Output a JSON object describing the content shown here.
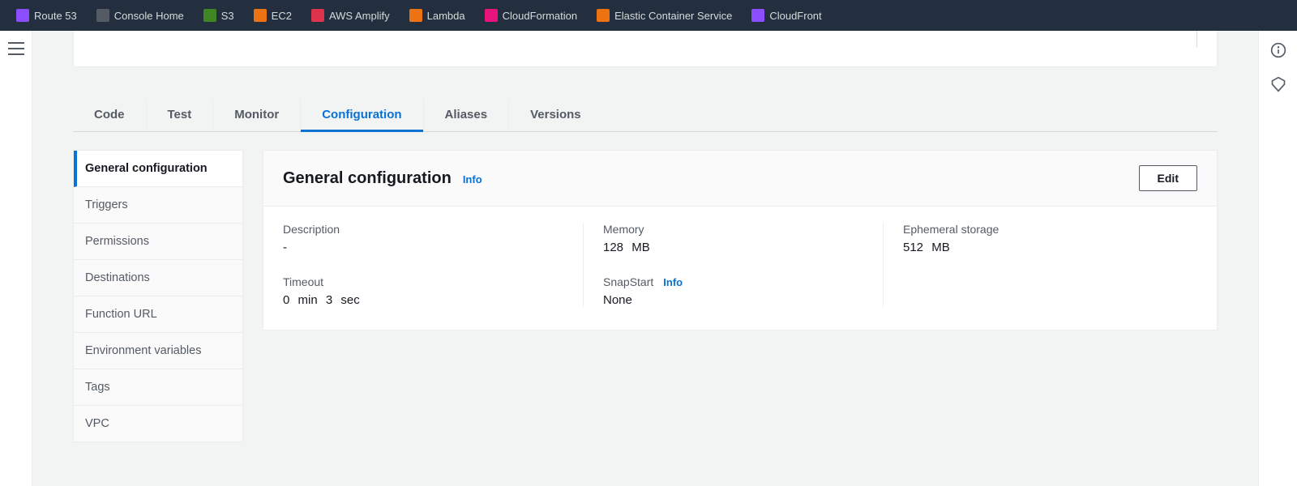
{
  "services": [
    {
      "label": "Route 53",
      "icon_color": "#8c4fff"
    },
    {
      "label": "Console Home",
      "icon_color": "#545b64"
    },
    {
      "label": "S3",
      "icon_color": "#3f8624"
    },
    {
      "label": "EC2",
      "icon_color": "#ed7211"
    },
    {
      "label": "AWS Amplify",
      "icon_color": "#dd344c"
    },
    {
      "label": "Lambda",
      "icon_color": "#ed7211"
    },
    {
      "label": "CloudFormation",
      "icon_color": "#e7157b"
    },
    {
      "label": "Elastic Container Service",
      "icon_color": "#ed7211"
    },
    {
      "label": "CloudFront",
      "icon_color": "#8c4fff"
    }
  ],
  "tabs": [
    {
      "label": "Code",
      "active": false
    },
    {
      "label": "Test",
      "active": false
    },
    {
      "label": "Monitor",
      "active": false
    },
    {
      "label": "Configuration",
      "active": true
    },
    {
      "label": "Aliases",
      "active": false
    },
    {
      "label": "Versions",
      "active": false
    }
  ],
  "side_nav": [
    {
      "label": "General configuration",
      "active": true
    },
    {
      "label": "Triggers",
      "active": false
    },
    {
      "label": "Permissions",
      "active": false
    },
    {
      "label": "Destinations",
      "active": false
    },
    {
      "label": "Function URL",
      "active": false
    },
    {
      "label": "Environment variables",
      "active": false
    },
    {
      "label": "Tags",
      "active": false
    },
    {
      "label": "VPC",
      "active": false
    }
  ],
  "panel": {
    "title": "General configuration",
    "info": "Info",
    "edit": "Edit",
    "fields": {
      "description_label": "Description",
      "description_value": "-",
      "timeout_label": "Timeout",
      "timeout_value": "0 min 3 sec",
      "memory_label": "Memory",
      "memory_value": "128 MB",
      "snapstart_label": "SnapStart",
      "snapstart_info": "Info",
      "snapstart_value": "None",
      "ephemeral_label": "Ephemeral storage",
      "ephemeral_value": "512 MB"
    }
  }
}
